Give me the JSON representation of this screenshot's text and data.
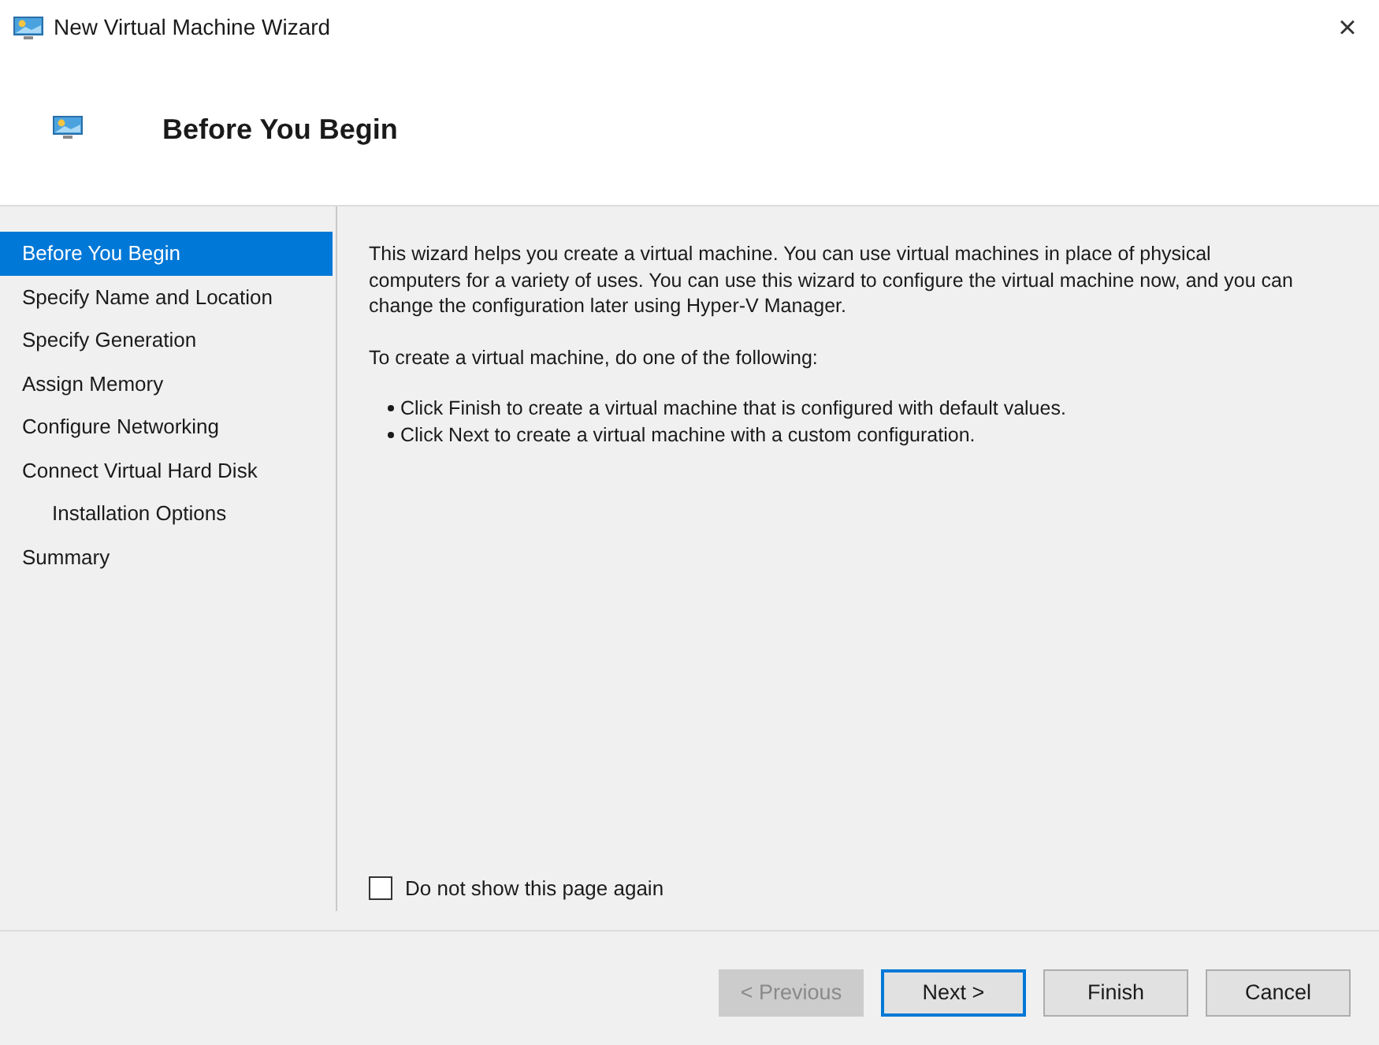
{
  "window": {
    "title": "New Virtual Machine Wizard",
    "close": "×"
  },
  "header": {
    "title": "Before You Begin"
  },
  "steps": [
    {
      "label": "Before You Begin",
      "selected": true
    },
    {
      "label": "Specify Name and Location",
      "selected": false
    },
    {
      "label": "Specify Generation",
      "selected": false
    },
    {
      "label": "Assign Memory",
      "selected": false
    },
    {
      "label": "Configure Networking",
      "selected": false
    },
    {
      "label": "Connect Virtual Hard Disk",
      "selected": false,
      "children": [
        {
          "label": "Installation Options",
          "selected": false
        }
      ]
    },
    {
      "label": "Summary",
      "selected": false
    }
  ],
  "content": {
    "intro": "This wizard helps you create a virtual machine. You can use virtual machines in place of physical computers for a variety of uses. You can use this wizard to configure the virtual machine now, and you can change the configuration later using Hyper-V Manager.",
    "prompt": "To create a virtual machine, do one of the following:",
    "bullets": [
      "Click Finish to create a virtual machine that is configured with default values.",
      "Click Next to create a virtual machine with a custom configuration."
    ]
  },
  "dont_show": {
    "label": "Do not show this page again",
    "checked": false
  },
  "buttons": [
    {
      "label": "< Previous",
      "disabled": true,
      "default": false
    },
    {
      "label": "Next >",
      "disabled": false,
      "default": true
    },
    {
      "label": "Finish",
      "disabled": false,
      "default": false
    },
    {
      "label": "Cancel",
      "disabled": false,
      "default": false
    }
  ]
}
